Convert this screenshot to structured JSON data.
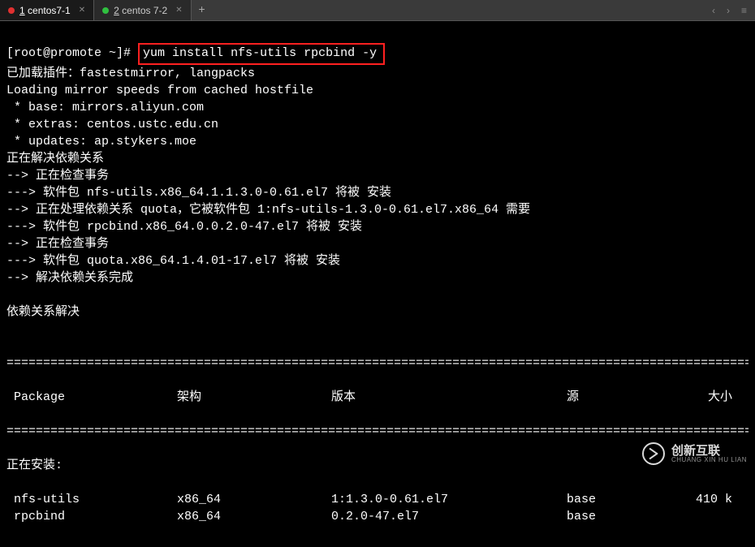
{
  "tabs": [
    {
      "num": "1",
      "label": "centos7-1",
      "dot": "red",
      "active": true
    },
    {
      "num": "2",
      "label": "centos 7-2",
      "dot": "green",
      "active": false
    }
  ],
  "prompt": "[root@promote ~]#",
  "command": "yum install nfs-utils rpcbind -y",
  "output_lines": [
    "已加载插件：fastestmirror, langpacks",
    "Loading mirror speeds from cached hostfile",
    " * base: mirrors.aliyun.com",
    " * extras: centos.ustc.edu.cn",
    " * updates: ap.stykers.moe",
    "正在解决依赖关系",
    "--> 正在检查事务",
    "---> 软件包 nfs-utils.x86_64.1.1.3.0-0.61.el7 将被 安装",
    "--> 正在处理依赖关系 quota，它被软件包 1:nfs-utils-1.3.0-0.61.el7.x86_64 需要",
    "---> 软件包 rpcbind.x86_64.0.0.2.0-47.el7 将被 安装",
    "--> 正在检查事务",
    "---> 软件包 quota.x86_64.1.4.01-17.el7 将被 安装",
    "--> 解决依赖关系完成",
    "",
    "依赖关系解决",
    ""
  ],
  "table": {
    "headers": {
      "pkg": " Package",
      "arch": "架构",
      "ver": "版本",
      "repo": "源",
      "size": "大小"
    },
    "install_header": "正在安装:",
    "rows": [
      {
        "pkg": " nfs-utils",
        "arch": "x86_64",
        "ver": "1:1.3.0-0.61.el7",
        "repo": "base",
        "size": "410 k"
      },
      {
        "pkg": " rpcbind",
        "arch": "x86_64",
        "ver": "0.2.0-47.el7",
        "repo": "base",
        "size": ""
      }
    ]
  },
  "separator": "=================================================================================================================",
  "watermark": {
    "cn": "创新互联",
    "en": "CHUANG XIN HU LIAN"
  }
}
